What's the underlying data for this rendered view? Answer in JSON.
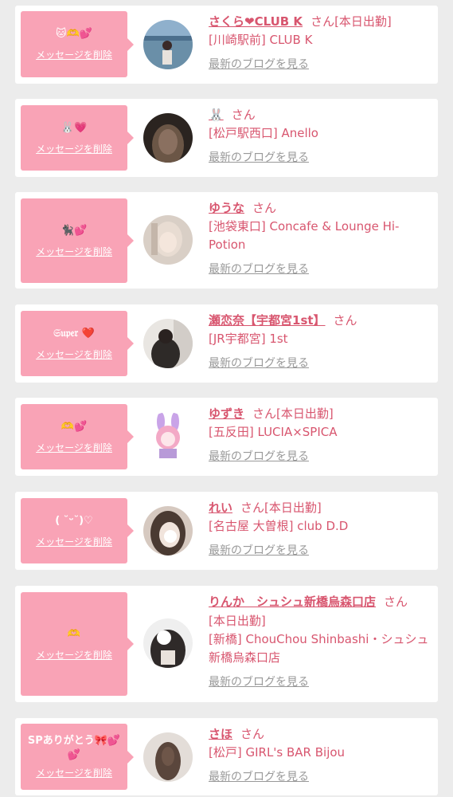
{
  "delete_label": "メッセージを削除",
  "san": "さん",
  "blog_label": "最新のブログを見る",
  "colors": {
    "pink": "#f9a3b6",
    "accent": "#d8566f",
    "muted": "#999999",
    "bg": "#ececec"
  },
  "items": [
    {
      "message": "🐱🫶💕",
      "name": "さくら❤CLUB K",
      "shift": "[本日出勤]",
      "shop": "[川崎駅前] CLUB K"
    },
    {
      "message": "🐰💗",
      "name": "🐰",
      "shift": "",
      "shop": "[松戸駅西口] Anello"
    },
    {
      "message": "🐈‍⬛💕",
      "name": "ゆうな",
      "shift": "",
      "shop": "[池袋東口] Concafe & Lounge Hi-Potion"
    },
    {
      "message": "𝔖𝔲𝔭𝔢𝔯 ❤️",
      "name": "瀬恋奈【宇都宮1st】",
      "shift": "",
      "shop": "[JR宇都宮] 1st"
    },
    {
      "message": "🫶💕",
      "name": "ゆずき",
      "shift": "[本日出勤]",
      "shop": "[五反田] LUCIA×SPICA"
    },
    {
      "message": "( ˘ᵕ˘)♡",
      "name": "れい",
      "shift": "[本日出勤]",
      "shop": "[名古屋 大曽根] club D.D"
    },
    {
      "message": "🫶",
      "name": "りんか　シュシュ新橋烏森口店",
      "shift": "[本日出勤]",
      "shop": "[新橋] ChouChou Shinbashi・シュシュ新橋烏森口店"
    },
    {
      "message": "SPありがとう🎀💕💕",
      "name": "さほ",
      "shift": "",
      "shop": "[松戸] GIRL's BAR Bijou"
    }
  ]
}
